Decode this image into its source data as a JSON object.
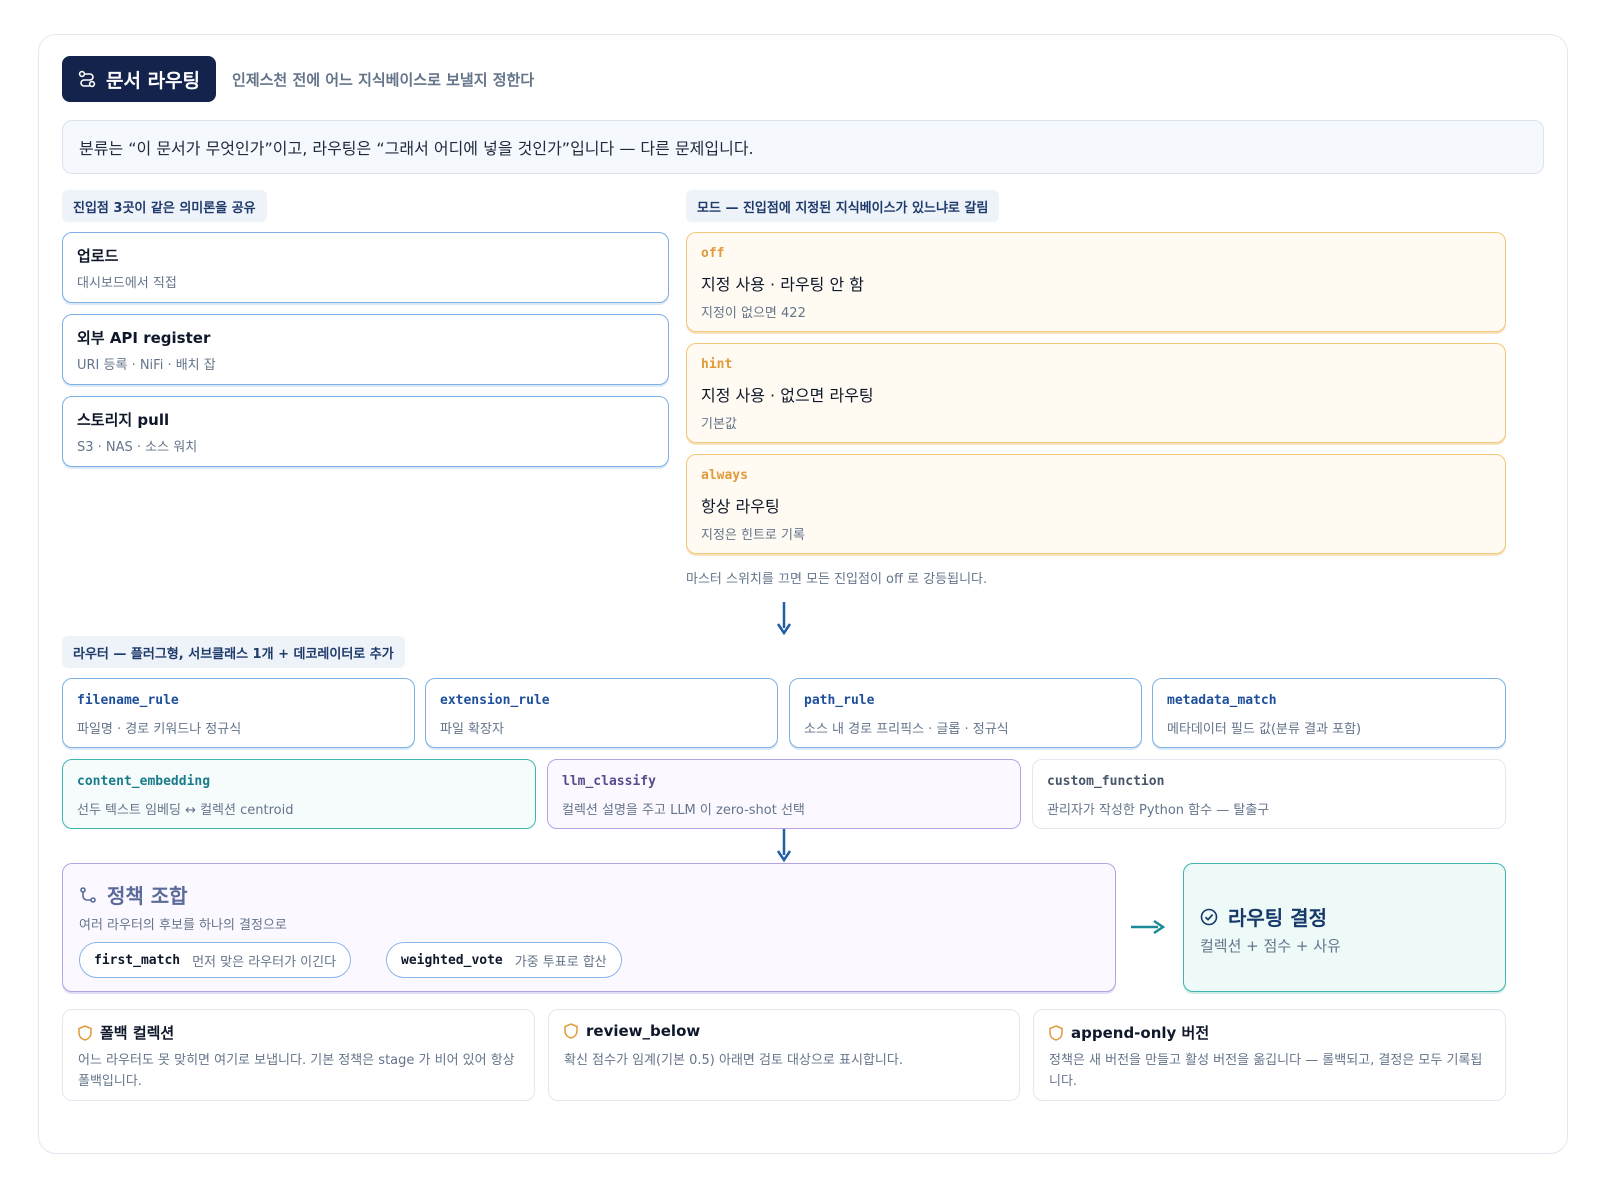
{
  "header": {
    "title": "문서 라우팅",
    "subtitle": "인제스천 전에 어느 지식베이스로 보낼지 정한다",
    "icon": "route-icon"
  },
  "intro": "분류는 “이 문서가 무엇인가”이고, 라우팅은 “그래서 어디에 넣을 것인가”입니다 — 다른 문제입니다.",
  "entry_points": {
    "tag": "진입점 3곳이 같은 의미론을 공유",
    "items": [
      {
        "title": "업로드",
        "desc": "대시보드에서 직접"
      },
      {
        "title": "외부 API register",
        "desc": "URI 등록 · NiFi · 배치 잡"
      },
      {
        "title": "스토리지 pull",
        "desc": "S3 · NAS · 소스 워치"
      }
    ]
  },
  "modes": {
    "tag": "모드 — 진입점에 지정된 지식베이스가 있느냐로 갈림",
    "items": [
      {
        "key": "off",
        "title": "지정 사용 · 라우팅 안 함",
        "desc": "지정이 없으면 422"
      },
      {
        "key": "hint",
        "title": "지정 사용 · 없으면 라우팅",
        "desc": "기본값"
      },
      {
        "key": "always",
        "title": "항상 라우팅",
        "desc": "지정은 힌트로 기록"
      }
    ],
    "note": "마스터 스위치를 끄면 모든 진입점이 off 로 강등됩니다."
  },
  "routers": {
    "tag": "라우터 — 플러그형, 서브클래스 1개 + 데코레이터로 추가",
    "items": [
      {
        "key": "filename_rule",
        "desc": "파일명 · 경로 키워드나 정규식"
      },
      {
        "key": "extension_rule",
        "desc": "파일 확장자"
      },
      {
        "key": "path_rule",
        "desc": "소스 내 경로 프리픽스 · 글롭 · 정규식"
      },
      {
        "key": "metadata_match",
        "desc": "메타데이터 필드 값(분류 결과 포함)"
      },
      {
        "key": "content_embedding",
        "desc": "선두 텍스트 임베딩 ↔ 컬렉션 centroid"
      },
      {
        "key": "llm_classify",
        "desc": "컬렉션 설명을 주고 LLM 이 zero-shot 선택"
      },
      {
        "key": "custom_function",
        "desc": "관리자가 작성한 Python 함수 — 탈출구"
      }
    ]
  },
  "policy": {
    "title": "정책 조합",
    "desc": "여러 라우터의 후보를 하나의 결정으로",
    "chips": [
      {
        "key": "first_match",
        "desc": "먼저 맞은 라우터가 이긴다"
      },
      {
        "key": "weighted_vote",
        "desc": "가중 투표로 합산"
      }
    ]
  },
  "decision": {
    "title": "라우팅 결정",
    "desc": "컬렉션 + 점수 + 사유"
  },
  "notes": [
    {
      "title": "폴백 컬렉션",
      "desc": "어느 라우터도 못 맞히면 여기로 보냅니다. 기본 정책은 stage 가 비어 있어 항상 폴백입니다."
    },
    {
      "title": "review_below",
      "desc": "확신 점수가 임계(기본 0.5) 아래면 검토 대상으로 표시합니다."
    },
    {
      "title": "append-only 버전",
      "desc": "정책은 새 버전을 만들고 활성 버전을 옮깁니다 — 롤백되고, 결정은 모두 기록됩니다."
    }
  ],
  "colors": {
    "navy": "#14234b",
    "blue": "#7db1e6",
    "amber": "#f3c77a",
    "teal": "#3fb5b0",
    "purple": "#b5a3e6",
    "arrow": "#1e5fa8"
  }
}
